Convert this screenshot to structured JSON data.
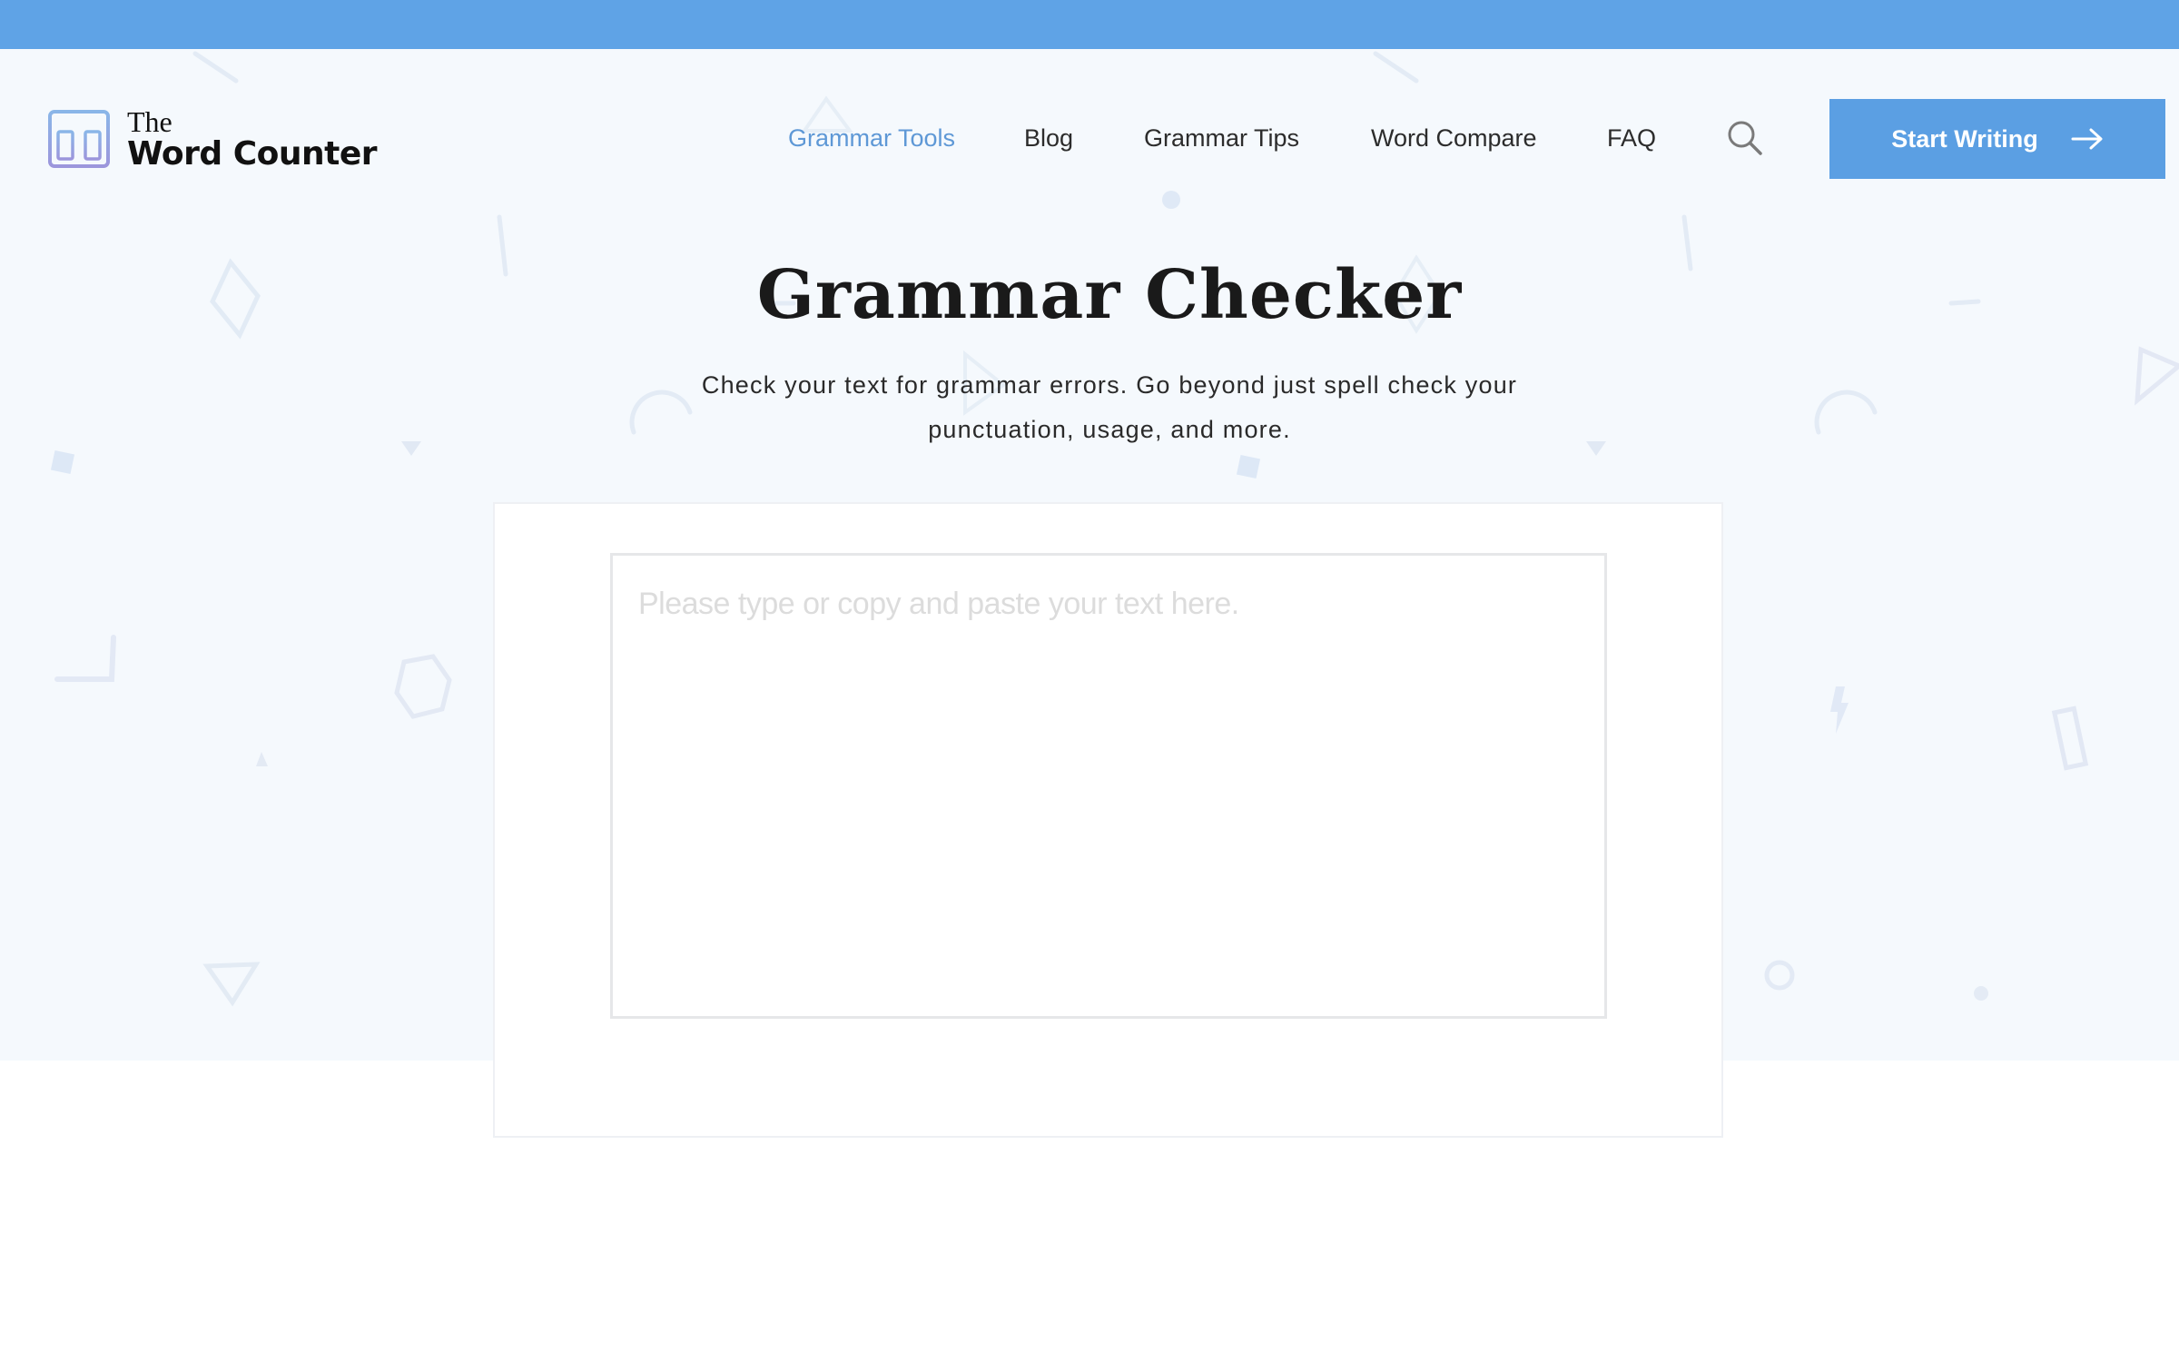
{
  "brand": {
    "line1": "The",
    "line2": "Word Counter",
    "icon": "calculator-display-icon"
  },
  "colors": {
    "top_bar": "#5fa3e6",
    "accent": "#5b9fe3",
    "nav_active": "#5e98d6",
    "hero_background": "#f5f9fd"
  },
  "nav": {
    "items": [
      {
        "label": "Grammar Tools",
        "active": true
      },
      {
        "label": "Blog",
        "active": false
      },
      {
        "label": "Grammar Tips",
        "active": false
      },
      {
        "label": "Word Compare",
        "active": false
      },
      {
        "label": "FAQ",
        "active": false
      }
    ],
    "search_icon": "search-icon"
  },
  "cta": {
    "label": "Start Writing",
    "icon": "arrow-right-icon"
  },
  "hero": {
    "title": "Grammar Checker",
    "subtitle_line1": "Check your text for grammar errors. Go beyond just spell check your",
    "subtitle_line2": "punctuation, usage, and more."
  },
  "editor": {
    "value": "",
    "placeholder": "Please type or copy and paste your text here."
  }
}
